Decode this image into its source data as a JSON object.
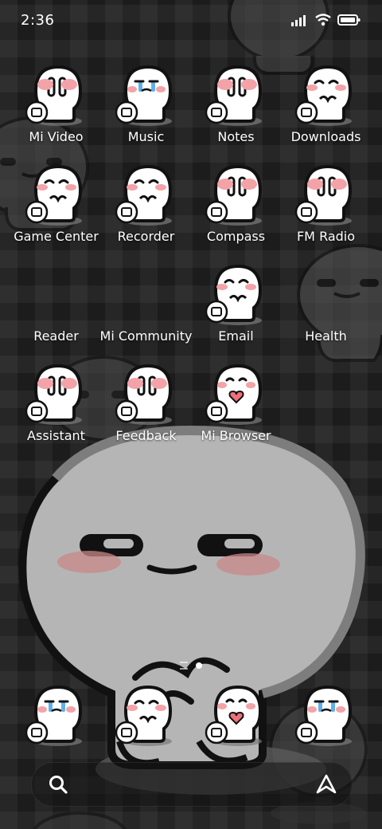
{
  "status_bar": {
    "time": "2:36"
  },
  "apps": [
    {
      "label": "Mi Video",
      "badge": "video-icon",
      "face": "blush"
    },
    {
      "label": "Music",
      "badge": "music-disc-icon",
      "face": "cry"
    },
    {
      "label": "Notes",
      "badge": "notes-icon",
      "face": "blush"
    },
    {
      "label": "Downloads",
      "badge": "download-icon",
      "face": "happy"
    },
    {
      "label": "Game Center",
      "badge": "gamepad-icon",
      "face": "happy"
    },
    {
      "label": "Recorder",
      "badge": "recorder-icon",
      "face": "happy"
    },
    {
      "label": "Compass",
      "badge": "compass-icon",
      "face": "blush"
    },
    {
      "label": "FM Radio",
      "badge": "radio-icon",
      "face": "blush"
    },
    {
      "label": "Reader",
      "badge": "",
      "face": ""
    },
    {
      "label": "Mi Community",
      "badge": "",
      "face": ""
    },
    {
      "label": "Email",
      "badge": "mail-icon",
      "face": "happy"
    },
    {
      "label": "Health",
      "badge": "",
      "face": ""
    },
    {
      "label": "Assistant",
      "badge": "microphone-icon",
      "face": "blush"
    },
    {
      "label": "Feedback",
      "badge": "heart-chat-icon",
      "face": "blush"
    },
    {
      "label": "Mi Browser",
      "badge": "browser-icon",
      "face": "heart"
    }
  ],
  "dock": [
    {
      "name": "phone",
      "badge": "phone-icon",
      "face": "cry"
    },
    {
      "name": "messages",
      "badge": "message-icon",
      "face": "happy"
    },
    {
      "name": "browser",
      "badge": "browser-icon",
      "face": "heart"
    },
    {
      "name": "camera",
      "badge": "camera-icon",
      "face": "cry"
    }
  ],
  "page_indicator": {
    "pages": 2,
    "active": 1
  },
  "search_bar": {
    "icon": "search-icon",
    "assistant_icon": "assistant-icon"
  }
}
